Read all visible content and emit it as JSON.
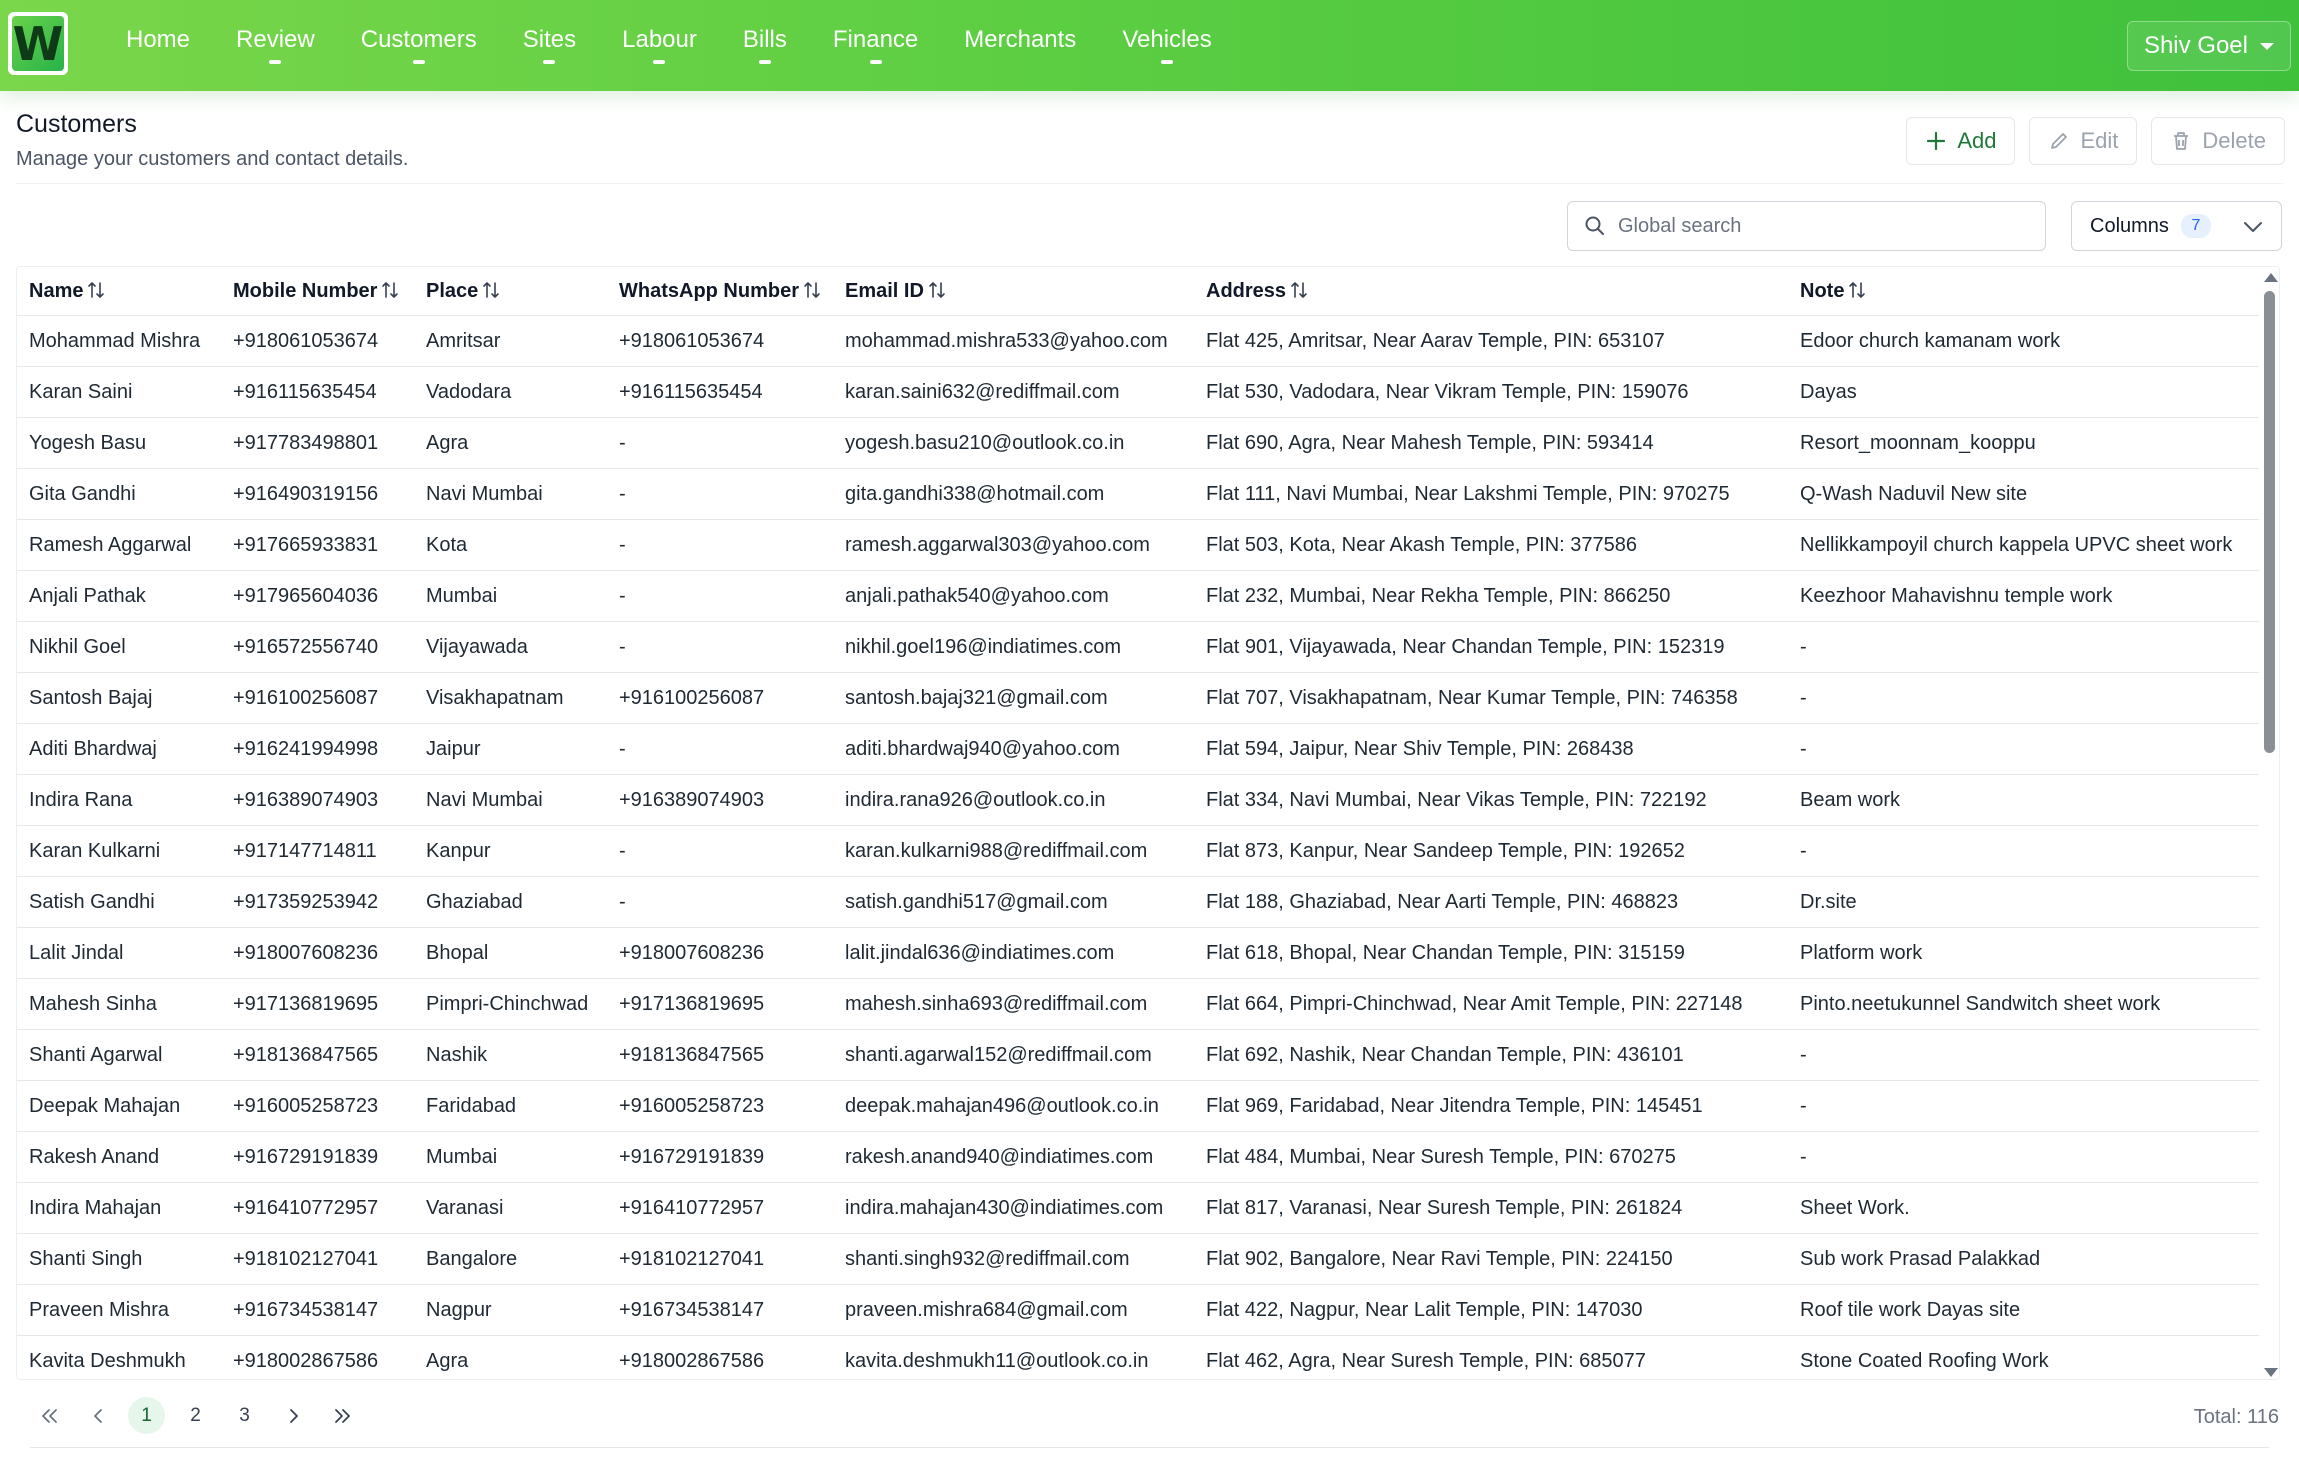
{
  "app": {
    "logo_letter": "W",
    "nav": [
      {
        "label": "Home",
        "indicator": false
      },
      {
        "label": "Review",
        "indicator": true
      },
      {
        "label": "Customers",
        "indicator": true
      },
      {
        "label": "Sites",
        "indicator": true
      },
      {
        "label": "Labour",
        "indicator": true
      },
      {
        "label": "Bills",
        "indicator": true
      },
      {
        "label": "Finance",
        "indicator": true
      },
      {
        "label": "Merchants",
        "indicator": false
      },
      {
        "label": "Vehicles",
        "indicator": true
      }
    ],
    "user": "Shiv Goel",
    "accent": "#3fc13c"
  },
  "page": {
    "title": "Customers",
    "subtitle": "Manage your customers and contact details.",
    "actions": {
      "add": "Add",
      "edit": "Edit",
      "delete": "Delete"
    }
  },
  "toolbar": {
    "search_placeholder": "Global search",
    "columns_label": "Columns",
    "columns_count": "7"
  },
  "table": {
    "columns": [
      "Name",
      "Mobile Number",
      "Place",
      "WhatsApp Number",
      "Email ID",
      "Address",
      "Note"
    ],
    "rows": [
      [
        "Mohammad Mishra",
        "+918061053674",
        "Amritsar",
        "+918061053674",
        "mohammad.mishra533@yahoo.com",
        "Flat 425, Amritsar, Near Aarav Temple, PIN: 653107",
        "Edoor church kamanam work"
      ],
      [
        "Karan Saini",
        "+916115635454",
        "Vadodara",
        "+916115635454",
        "karan.saini632@rediffmail.com",
        "Flat 530, Vadodara, Near Vikram Temple, PIN: 159076",
        "Dayas"
      ],
      [
        "Yogesh Basu",
        "+917783498801",
        "Agra",
        "-",
        "yogesh.basu210@outlook.co.in",
        "Flat 690, Agra, Near Mahesh Temple, PIN: 593414",
        "Resort_moonnam_kooppu"
      ],
      [
        "Gita Gandhi",
        "+916490319156",
        "Navi Mumbai",
        "-",
        "gita.gandhi338@hotmail.com",
        "Flat 111, Navi Mumbai, Near Lakshmi Temple, PIN: 970275",
        "Q-Wash Naduvil New site"
      ],
      [
        "Ramesh Aggarwal",
        "+917665933831",
        "Kota",
        "-",
        "ramesh.aggarwal303@yahoo.com",
        "Flat 503, Kota, Near Akash Temple, PIN: 377586",
        "Nellikkampoyil church kappela UPVC sheet work"
      ],
      [
        "Anjali Pathak",
        "+917965604036",
        "Mumbai",
        "-",
        "anjali.pathak540@yahoo.com",
        "Flat 232, Mumbai, Near Rekha Temple, PIN: 866250",
        "Keezhoor Mahavishnu temple work"
      ],
      [
        "Nikhil Goel",
        "+916572556740",
        "Vijayawada",
        "-",
        "nikhil.goel196@indiatimes.com",
        "Flat 901, Vijayawada, Near Chandan Temple, PIN: 152319",
        "-"
      ],
      [
        "Santosh Bajaj",
        "+916100256087",
        "Visakhapatnam",
        "+916100256087",
        "santosh.bajaj321@gmail.com",
        "Flat 707, Visakhapatnam, Near Kumar Temple, PIN: 746358",
        "-"
      ],
      [
        "Aditi Bhardwaj",
        "+916241994998",
        "Jaipur",
        "-",
        "aditi.bhardwaj940@yahoo.com",
        "Flat 594, Jaipur, Near Shiv Temple, PIN: 268438",
        "-"
      ],
      [
        "Indira Rana",
        "+916389074903",
        "Navi Mumbai",
        "+916389074903",
        "indira.rana926@outlook.co.in",
        "Flat 334, Navi Mumbai, Near Vikas Temple, PIN: 722192",
        "Beam work"
      ],
      [
        "Karan Kulkarni",
        "+917147714811",
        "Kanpur",
        "-",
        "karan.kulkarni988@rediffmail.com",
        "Flat 873, Kanpur, Near Sandeep Temple, PIN: 192652",
        "-"
      ],
      [
        "Satish Gandhi",
        "+917359253942",
        "Ghaziabad",
        "-",
        "satish.gandhi517@gmail.com",
        "Flat 188, Ghaziabad, Near Aarti Temple, PIN: 468823",
        "Dr.site"
      ],
      [
        "Lalit Jindal",
        "+918007608236",
        "Bhopal",
        "+918007608236",
        "lalit.jindal636@indiatimes.com",
        "Flat 618, Bhopal, Near Chandan Temple, PIN: 315159",
        "Platform work"
      ],
      [
        "Mahesh Sinha",
        "+917136819695",
        "Pimpri-Chinchwad",
        "+917136819695",
        "mahesh.sinha693@rediffmail.com",
        "Flat 664, Pimpri-Chinchwad, Near Amit Temple, PIN: 227148",
        "Pinto.neetukunnel Sandwitch sheet work"
      ],
      [
        "Shanti Agarwal",
        "+918136847565",
        "Nashik",
        "+918136847565",
        "shanti.agarwal152@rediffmail.com",
        "Flat 692, Nashik, Near Chandan Temple, PIN: 436101",
        "-"
      ],
      [
        "Deepak Mahajan",
        "+916005258723",
        "Faridabad",
        "+916005258723",
        "deepak.mahajan496@outlook.co.in",
        "Flat 969, Faridabad, Near Jitendra Temple, PIN: 145451",
        "-"
      ],
      [
        "Rakesh Anand",
        "+916729191839",
        "Mumbai",
        "+916729191839",
        "rakesh.anand940@indiatimes.com",
        "Flat 484, Mumbai, Near Suresh Temple, PIN: 670275",
        "-"
      ],
      [
        "Indira Mahajan",
        "+916410772957",
        "Varanasi",
        "+916410772957",
        "indira.mahajan430@indiatimes.com",
        "Flat 817, Varanasi, Near Suresh Temple, PIN: 261824",
        "Sheet Work."
      ],
      [
        "Shanti Singh",
        "+918102127041",
        "Bangalore",
        "+918102127041",
        "shanti.singh932@rediffmail.com",
        "Flat 902, Bangalore, Near Ravi Temple, PIN: 224150",
        "Sub work Prasad Palakkad"
      ],
      [
        "Praveen Mishra",
        "+916734538147",
        "Nagpur",
        "+916734538147",
        "praveen.mishra684@gmail.com",
        "Flat 422, Nagpur, Near Lalit Temple, PIN: 147030",
        "Roof tile work Dayas site"
      ],
      [
        "Kavita Deshmukh",
        "+918002867586",
        "Agra",
        "+918002867586",
        "kavita.deshmukh11@outlook.co.in",
        "Flat 462, Agra, Near Suresh Temple, PIN: 685077",
        "Stone Coated Roofing Work"
      ]
    ]
  },
  "pagination": {
    "pages": [
      "1",
      "2",
      "3"
    ],
    "current": "1",
    "total": "Total: 116"
  }
}
